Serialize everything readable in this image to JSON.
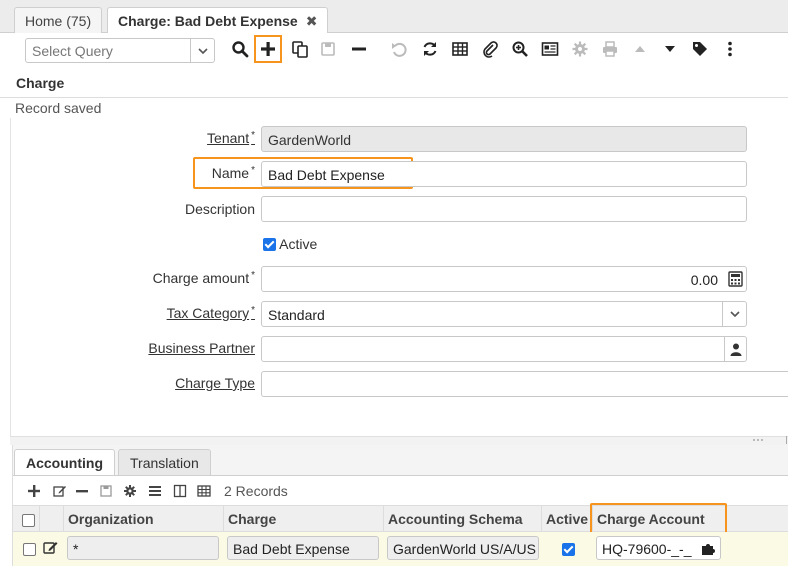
{
  "tabs": [
    {
      "label": "Home (75)"
    },
    {
      "label": "Charge: Bad Debt Expense"
    }
  ],
  "toolbar": {
    "query_placeholder": "Select Query"
  },
  "section_title": "Charge",
  "status_message": "Record saved",
  "form": {
    "tenant": {
      "label": "Tenant",
      "required_mark": "*",
      "value": "GardenWorld"
    },
    "name": {
      "label": "Name",
      "required_mark": "*",
      "value": "Bad Debt Expense"
    },
    "description": {
      "label": "Description",
      "value": ""
    },
    "active": {
      "label": "Active",
      "checked": true
    },
    "charge_amount": {
      "label": "Charge amount",
      "required_mark": "*",
      "value": "0.00"
    },
    "tax_category": {
      "label": "Tax Category",
      "required_mark": "*",
      "value": "Standard"
    },
    "business_partner": {
      "label": "Business Partner",
      "value": ""
    },
    "charge_type": {
      "label": "Charge Type",
      "value": ""
    }
  },
  "detail": {
    "tabs": [
      {
        "label": "Accounting"
      },
      {
        "label": "Translation"
      }
    ],
    "record_count": "2 Records",
    "columns": [
      "Organization",
      "Charge",
      "Accounting Schema",
      "Active",
      "Charge Account"
    ],
    "rows": [
      {
        "organization": "*",
        "charge": "Bad Debt Expense",
        "accounting_schema": "GardenWorld US/A/US",
        "active": true,
        "charge_account": "HQ-79600-_-_"
      }
    ]
  },
  "colors": {
    "highlight": "#f7941d",
    "checkbox": "#1a73e8",
    "row_highlight": "#fbfbe5"
  }
}
